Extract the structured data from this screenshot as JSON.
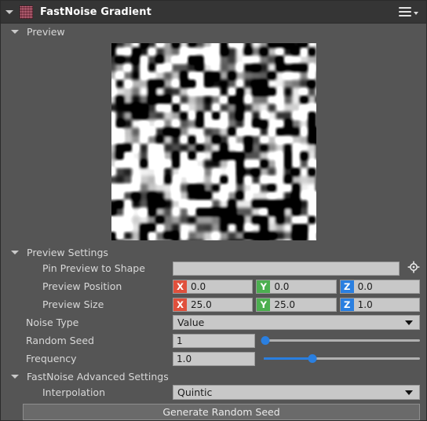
{
  "window": {
    "title": "FastNoise Gradient",
    "app_icon": "noise-pattern-icon",
    "menu_icon": "hamburger-menu-icon",
    "collapse_icon": "chevron-down-icon",
    "accent_colors": {
      "axis_x": "#e0503c",
      "axis_y": "#4caf50",
      "axis_z": "#2a7fe0",
      "slider": "#2a7fe0",
      "icon_pink": "#d63a5e",
      "titlebar_bg": "#353535",
      "window_bg": "#555555",
      "field_bg": "#c8c8c8"
    }
  },
  "sections": {
    "preview": {
      "label": "Preview",
      "expanded": true
    },
    "preview_settings": {
      "label": "Preview Settings",
      "expanded": true
    },
    "advanced": {
      "label": "FastNoise Advanced Settings",
      "expanded": true
    }
  },
  "rows": {
    "pin_preview": {
      "label": "Pin Preview to Shape",
      "value": "",
      "placeholder": "",
      "picker_icon": "target-crosshair-icon"
    },
    "preview_position": {
      "label": "Preview Position",
      "x": "0.0",
      "y": "0.0",
      "z": "0.0",
      "x_badge": "X",
      "y_badge": "Y",
      "z_badge": "Z"
    },
    "preview_size": {
      "label": "Preview Size",
      "x": "25.0",
      "y": "25.0",
      "z": "1.0",
      "x_badge": "X",
      "y_badge": "Y",
      "z_badge": "Z"
    },
    "noise_type": {
      "label": "Noise Type",
      "value": "Value"
    },
    "random_seed": {
      "label": "Random Seed",
      "value": "1",
      "slider_percent": 1
    },
    "frequency": {
      "label": "Frequency",
      "value": "1.0",
      "slider_percent": 31
    },
    "interpolation": {
      "label": "Interpolation",
      "value": "Quintic"
    }
  },
  "buttons": {
    "generate_random_seed": "Generate Random Seed"
  }
}
